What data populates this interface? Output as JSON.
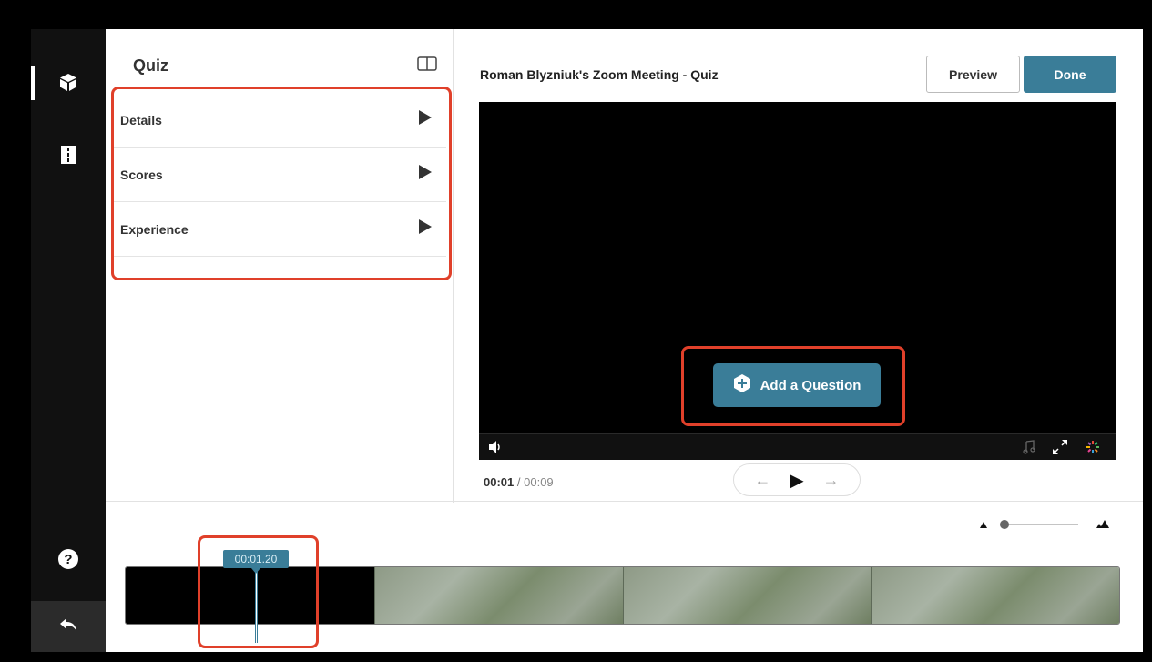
{
  "quiz_panel": {
    "title": "Quiz",
    "items": [
      {
        "label": "Details"
      },
      {
        "label": "Scores"
      },
      {
        "label": "Experience"
      }
    ]
  },
  "header": {
    "video_title": "Roman Blyzniuk's Zoom Meeting - Quiz",
    "preview_label": "Preview",
    "done_label": "Done"
  },
  "player": {
    "add_question_label": "Add a Question",
    "current_time": "00:01",
    "separator": "/",
    "total_time": "00:09"
  },
  "timeline": {
    "playhead_time": "00:01.20"
  },
  "icons": {
    "rail": [
      "cube-icon",
      "book-icon",
      "help-icon",
      "back-icon"
    ],
    "player": [
      "volume-icon",
      "music-icon",
      "fullscreen-icon",
      "logo-icon"
    ]
  },
  "colors": {
    "accent": "#3a7d98",
    "highlight": "#e0402a",
    "rail": "#111111"
  }
}
